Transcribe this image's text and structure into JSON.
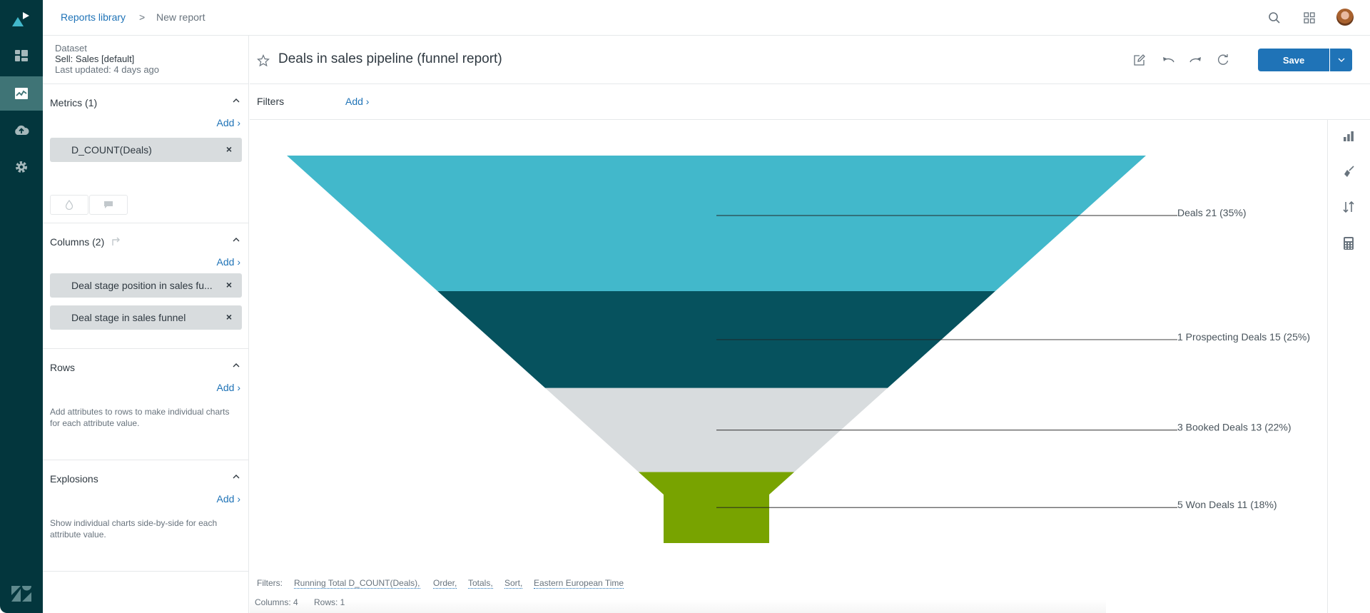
{
  "breadcrumb": {
    "parent": "Reports library",
    "separator": ">",
    "current": "New report"
  },
  "dataset": {
    "label": "Dataset",
    "name": "Sell: Sales [default]",
    "updated": "Last updated: 4 days ago"
  },
  "panel": {
    "metrics": {
      "title": "Metrics (1)",
      "add": "Add ›",
      "chips": [
        "D_COUNT(Deals)"
      ]
    },
    "columns": {
      "title": "Columns (2)",
      "add": "Add ›",
      "chips": [
        "Deal stage position in sales fu...",
        "Deal stage in sales funnel"
      ]
    },
    "rows": {
      "title": "Rows",
      "add": "Add ›",
      "description": "Add attributes to rows to make individual charts for each attribute value."
    },
    "explosions": {
      "title": "Explosions",
      "add": "Add ›",
      "description": "Show individual charts side-by-side for each attribute value."
    },
    "chip_remove": "×"
  },
  "report": {
    "title": "Deals in sales pipeline (funnel report)",
    "save": "Save"
  },
  "filters": {
    "label": "Filters",
    "add": "Add ›"
  },
  "footer": {
    "filters_label": "Filters:",
    "filters": [
      "Running Total D_COUNT(Deals),",
      "Order,",
      "Totals,",
      "Sort,",
      "Eastern European Time"
    ],
    "columns": "Columns: 4",
    "rows": "Rows: 1"
  },
  "colors": {
    "accent": "#1f73b7",
    "rail": "#03363d"
  },
  "chart_data": {
    "type": "funnel",
    "title": "Deals in sales pipeline (funnel report)",
    "metric": "D_COUNT(Deals)",
    "categories": [
      "Deals",
      "1 Prospecting Deals",
      "3 Booked Deals",
      "5 Won Deals"
    ],
    "values": [
      21,
      15,
      13,
      11
    ],
    "percents": [
      35,
      25,
      22,
      18
    ],
    "labels": [
      "Deals 21 (35%)",
      "1 Prospecting Deals 15 (25%)",
      "3 Booked Deals 13 (22%)",
      "5 Won Deals 11 (18%)"
    ],
    "colors": [
      "#42b8cb",
      "#06525e",
      "#d8dcde",
      "#78a300"
    ]
  }
}
